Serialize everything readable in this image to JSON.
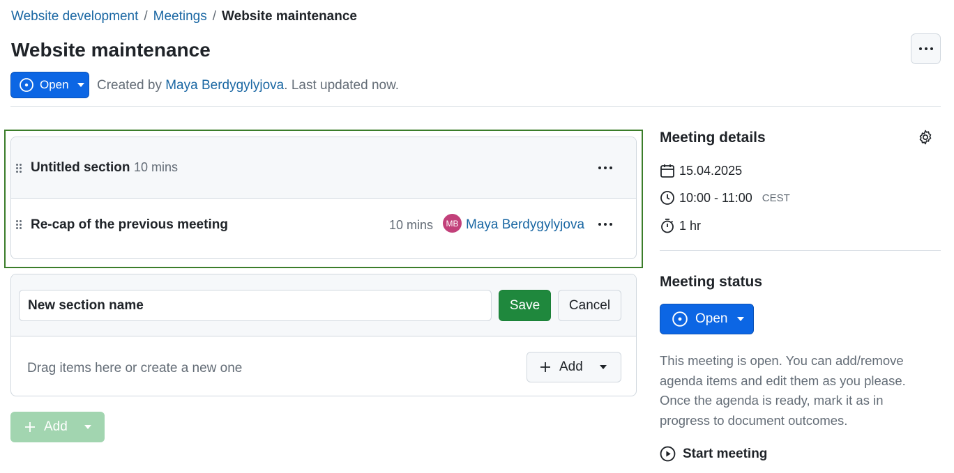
{
  "breadcrumb": {
    "project": "Website development",
    "module": "Meetings",
    "current": "Website maintenance",
    "separator": "/"
  },
  "page_title": "Website maintenance",
  "status": {
    "label": "Open",
    "color": "#0c66e4"
  },
  "meta": {
    "created_prefix": "Created by ",
    "author": "Maya Berdygylyjova",
    "updated_suffix": ". Last updated now."
  },
  "agenda": {
    "section": {
      "title": "Untitled section",
      "duration": "10 mins"
    },
    "items": [
      {
        "title": "Re-cap of the previous meeting",
        "duration": "10 mins",
        "owner_initials": "MB",
        "owner": "Maya Berdygylyjova"
      }
    ]
  },
  "new_section": {
    "input_value": "New section name",
    "save_label": "Save",
    "cancel_label": "Cancel",
    "drop_text": "Drag items here or create a new one",
    "add_label": "Add"
  },
  "add_button_label": "Add",
  "sidebar": {
    "details_title": "Meeting details",
    "date": "15.04.2025",
    "time": "10:00 - 11:00",
    "timezone": "CEST",
    "duration": "1 hr",
    "status_title": "Meeting status",
    "status_label": "Open",
    "status_description": "This meeting is open. You can add/remove agenda items and edit them as you please. Once the agenda is ready, mark it as in progress to document outcomes.",
    "start_meeting_label": "Start meeting"
  },
  "colors": {
    "accent": "#0c66e4",
    "success": "#1f883d",
    "highlight_border": "#3b7d2a",
    "link": "#1a67a3"
  }
}
